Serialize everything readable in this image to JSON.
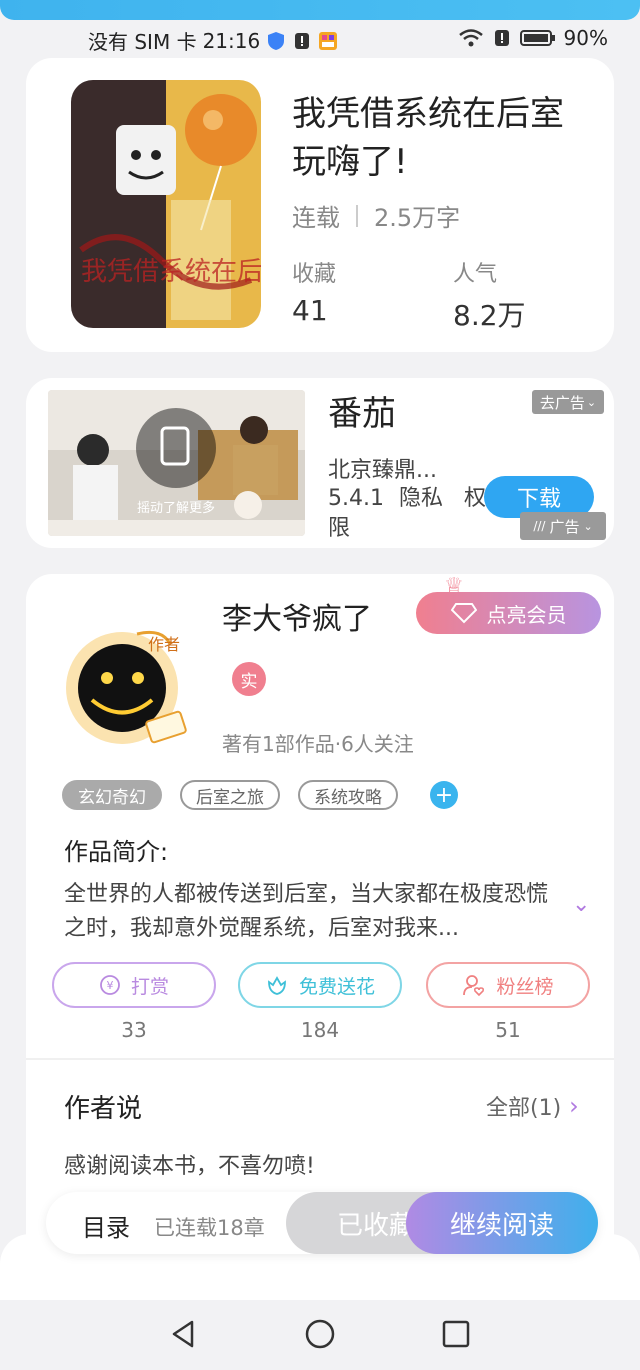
{
  "status_bar": {
    "carrier": "没有 SIM 卡",
    "time": "21:16",
    "battery": "90%"
  },
  "book": {
    "title": "我凭借系统在后室玩嗨了!",
    "status": "连载",
    "word_count": "2.5万字",
    "collect_label": "收藏",
    "collect_value": "41",
    "popularity_label": "人气",
    "popularity_value": "8.2万",
    "cover_text": "我凭借系统在后室玩嗨了"
  },
  "ad": {
    "app_name": "番茄",
    "company": "北京臻鼎...",
    "version": "5.4.1",
    "privacy": "隐私",
    "permission": "权限",
    "remove_label": "去广告",
    "download_label": "下载",
    "ad_label": "广告",
    "shake_hint": "摇动了解更多"
  },
  "author": {
    "name": "李大爷疯了",
    "vip_label": "点亮会员",
    "real_badge": "实",
    "avatar_tag": "作者",
    "works_info": "著有1部作品·6人关注",
    "tags": [
      "玄幻奇幻",
      "后室之旅",
      "系统攻略"
    ],
    "intro_title": "作品简介:",
    "intro_text": "全世界的人都被传送到后室，当大家都在极度恐慌之时，我却意外觉醒系统，后室对我来...",
    "actions": [
      {
        "label": "打赏",
        "count": "33",
        "color": "#b98ae0"
      },
      {
        "label": "免费送花",
        "count": "184",
        "color": "#3fc0d8"
      },
      {
        "label": "粉丝榜",
        "count": "51",
        "color": "#f08080"
      }
    ],
    "author_says_title": "作者说",
    "all_label": "全部(1)",
    "author_message": "感谢阅读本书，不喜勿喷!"
  },
  "bottom_bar": {
    "toc_label": "目录",
    "chapter_status": "已连载18章",
    "collected_label": "已收藏",
    "continue_label": "继续阅读"
  }
}
